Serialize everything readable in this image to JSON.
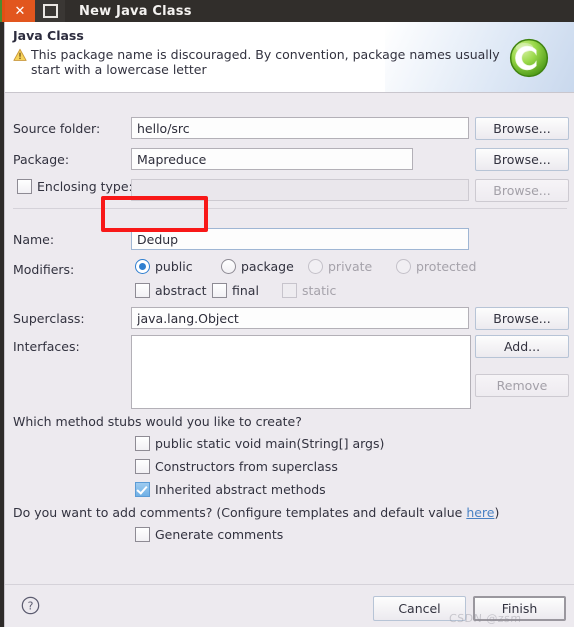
{
  "window": {
    "title": "New Java Class",
    "close_label": "✕",
    "maximize_label": "maximize"
  },
  "header": {
    "title": "Java Class",
    "warning_text": "This package name is discouraged. By convention, package names usually start with a lowercase letter",
    "warning_icon": "warning-triangle-icon",
    "class_icon": "java-class-badge-icon"
  },
  "fields": {
    "source_folder": {
      "label": "Source folder:",
      "value": "hello/src",
      "button": "Browse...",
      "enabled": true
    },
    "package": {
      "label": "Package:",
      "value": "Mapreduce",
      "button": "Browse...",
      "enabled": true
    },
    "enclosing_type": {
      "label": "Enclosing type:",
      "value": "",
      "button": "Browse...",
      "checked": false,
      "enabled": false
    },
    "name": {
      "label": "Name:",
      "value": "Dedup",
      "focused": true
    },
    "superclass": {
      "label": "Superclass:",
      "value": "java.lang.Object",
      "button": "Browse..."
    },
    "interfaces": {
      "label": "Interfaces:",
      "items": [],
      "add_button": "Add...",
      "remove_button": "Remove"
    }
  },
  "modifiers": {
    "label": "Modifiers:",
    "access": [
      {
        "label": "public",
        "selected": true,
        "enabled": true
      },
      {
        "label": "package",
        "selected": false,
        "enabled": true
      },
      {
        "label": "private",
        "selected": false,
        "enabled": false
      },
      {
        "label": "protected",
        "selected": false,
        "enabled": false
      }
    ],
    "flags": [
      {
        "label": "abstract",
        "checked": false,
        "enabled": true
      },
      {
        "label": "final",
        "checked": false,
        "enabled": true
      },
      {
        "label": "static",
        "checked": false,
        "enabled": false
      }
    ]
  },
  "stubs": {
    "question": "Which method stubs would you like to create?",
    "options": [
      {
        "label": "public static void main(String[] args)",
        "checked": false
      },
      {
        "label": "Constructors from superclass",
        "checked": false
      },
      {
        "label": "Inherited abstract methods",
        "checked": true
      }
    ]
  },
  "comments": {
    "question_prefix": "Do you want to add comments? (Configure templates and default value ",
    "link": "here",
    "question_suffix": ")",
    "option": {
      "label": "Generate comments",
      "checked": false
    }
  },
  "footer": {
    "help_icon": "help-question-icon",
    "cancel": "Cancel",
    "finish": "Finish"
  },
  "watermark": "CSDN @zsm",
  "colors": {
    "accent_blue": "#2f7fd0",
    "link": "#4a82c4",
    "annotation_red": "#f81818",
    "titlebar": "#312e2b",
    "close_button": "#e2561e",
    "dialog_bg": "#edeaef"
  }
}
